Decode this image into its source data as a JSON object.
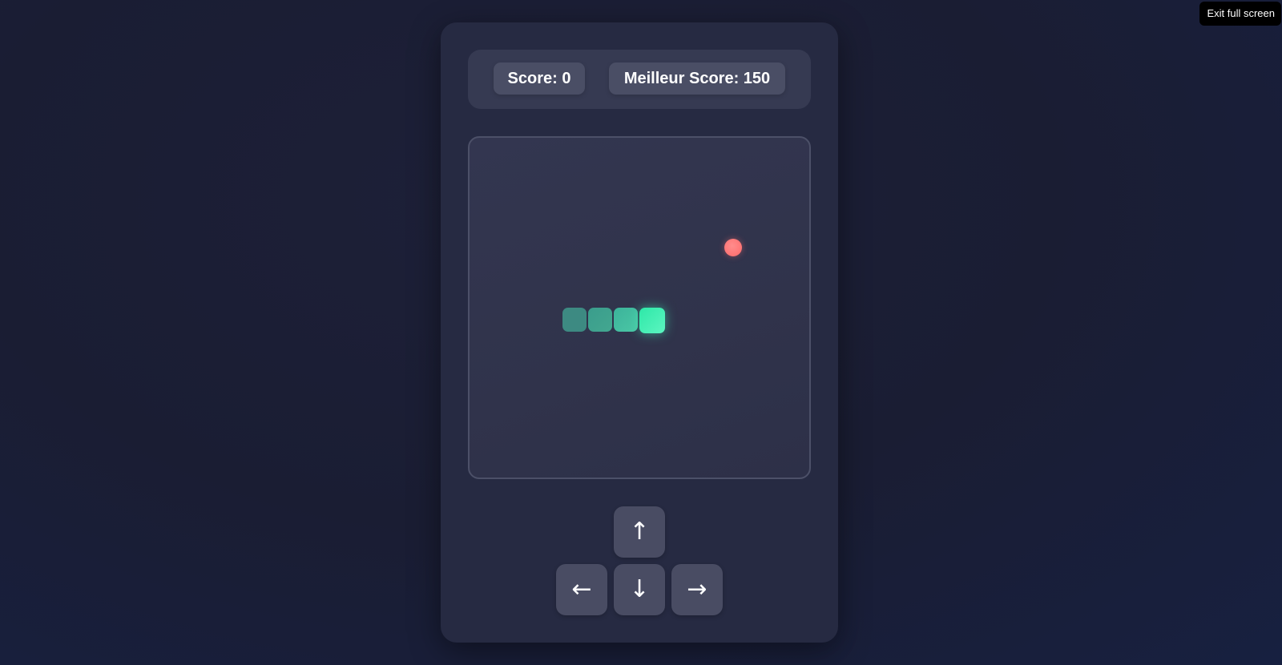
{
  "fullscreen": {
    "exit_label": "Exit full screen"
  },
  "scoreboard": {
    "score_text": "Score: 0",
    "best_score_text": "Meilleur Score: 150"
  },
  "controls": {
    "up_icon": "arrow-up",
    "up": "↑",
    "left_icon": "arrow-left",
    "left": "←",
    "down_icon": "arrow-down",
    "down": "↓",
    "right_icon": "arrow-right",
    "right": "→"
  },
  "colors": {
    "background": "#1a1d33",
    "panel": "#262a42",
    "snake_head": "#3ef0b0",
    "snake_tail": "#3d8a82",
    "food": "#ff7474"
  }
}
